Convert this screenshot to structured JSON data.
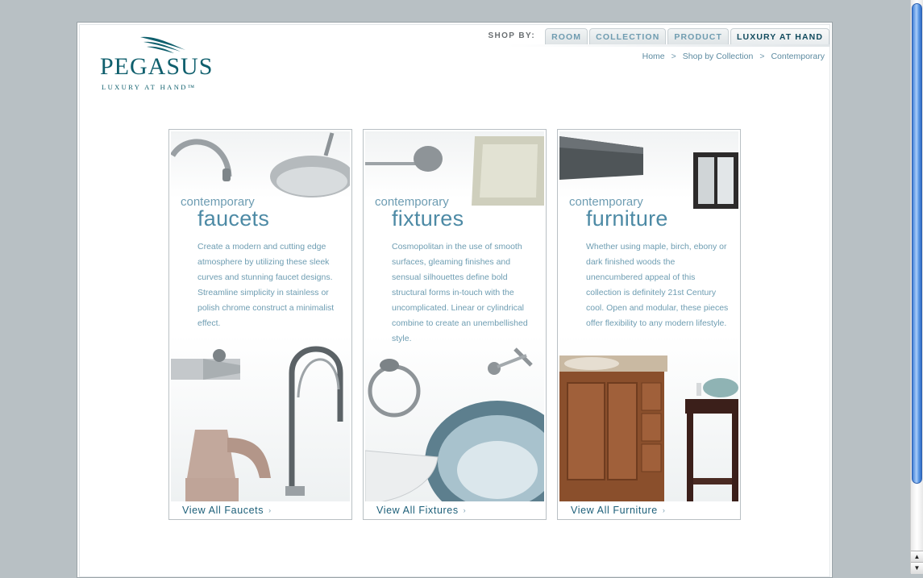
{
  "brand": {
    "name": "PEGASUS",
    "tagline": "LUXURY AT HAND™"
  },
  "shop_by": {
    "label": "SHOP BY:",
    "tabs": [
      {
        "label": "ROOM"
      },
      {
        "label": "COLLECTION"
      },
      {
        "label": "PRODUCT"
      },
      {
        "label": "LUXURY AT HAND"
      }
    ]
  },
  "breadcrumb": {
    "items": [
      "Home",
      "Shop by Collection",
      "Contemporary"
    ],
    "separator": ">"
  },
  "cards": [
    {
      "pre": "contemporary",
      "title": "faucets",
      "description": "Create a modern and cutting edge atmosphere by utilizing these sleek curves and stunning faucet designs. Streamline simplicity in stainless or polish chrome construct a minimalist effect.",
      "link": "View All Faucets",
      "link_arrow": "›"
    },
    {
      "pre": "contemporary",
      "title": "fixtures",
      "description": "Cosmopolitan in the use of smooth surfaces, gleaming finishes and sensual silhouettes define bold structural forms in-touch with the uncomplicated. Linear or cylindrical combine to create an unembellished style.",
      "link": "View All Fixtures",
      "link_arrow": "›"
    },
    {
      "pre": "contemporary",
      "title": "furniture",
      "description": "Whether using maple, birch, ebony or dark finished woods the unencumbered appeal of this collection is definitely 21st Century cool. Open and modular, these pieces offer flexibility to any modern lifestyle.",
      "link": "View All Furniture",
      "link_arrow": "›"
    }
  ],
  "colors": {
    "brand_teal": "#0f5f6d",
    "accent_blue": "#4d8aa5",
    "text_blue": "#6e9db2",
    "background": "#b8c0c4"
  }
}
